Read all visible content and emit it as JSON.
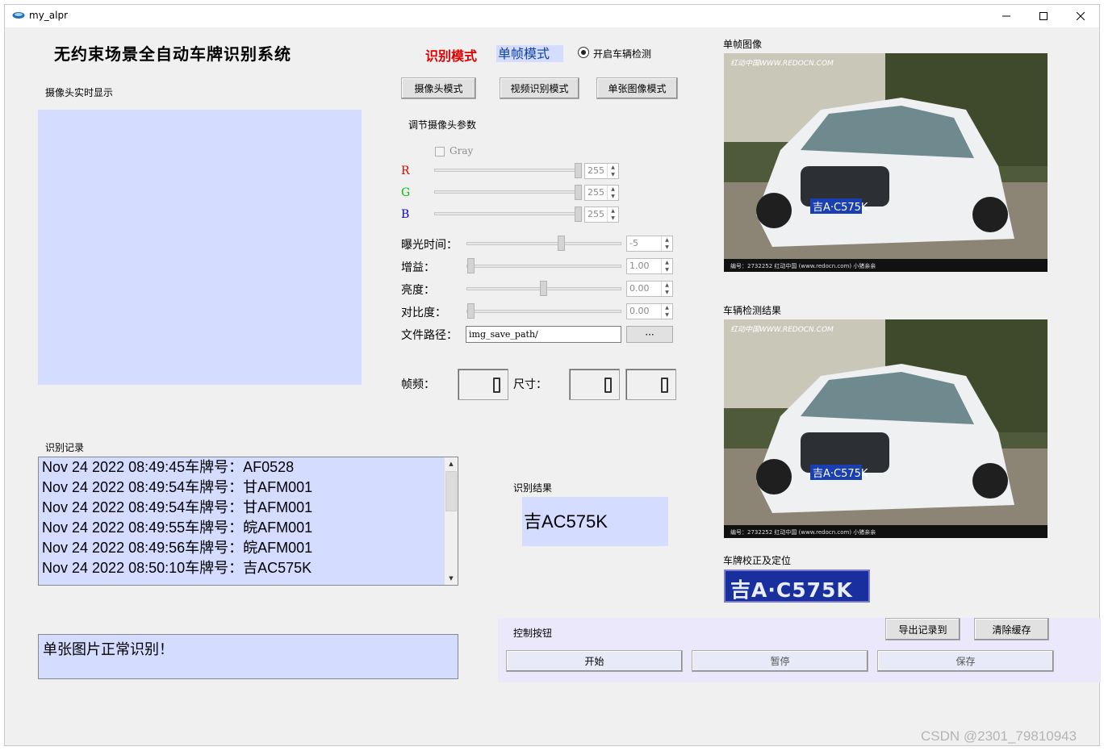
{
  "window": {
    "title": "my_alpr"
  },
  "header": {
    "system_title": "无约束场景全自动车牌识别系统",
    "mode_label": "识别模式",
    "mode_value": "单帧模式",
    "vehicle_detect_label": "开启车辆检测",
    "vehicle_detect_checked": true
  },
  "camera": {
    "label": "摄像头实时显示"
  },
  "mode_buttons": {
    "camera": "摄像头模式",
    "video": "视频识别模式",
    "single": "单张图像模式"
  },
  "params": {
    "title": "调节摄像头参数",
    "gray_label": "Gray",
    "r": {
      "label": "R",
      "value": "255",
      "color": "#e00000"
    },
    "g": {
      "label": "G",
      "value": "255",
      "color": "#00c000"
    },
    "b": {
      "label": "B",
      "value": "255",
      "color": "#0000e0"
    },
    "exposure": {
      "label": "曝光时间：",
      "value": "-5"
    },
    "gain": {
      "label": "增益：",
      "value": "1.00"
    },
    "brightness": {
      "label": "亮度：",
      "value": "0.00"
    },
    "contrast": {
      "label": "对比度：",
      "value": "0.00"
    },
    "filepath": {
      "label": "文件路径：",
      "value": "img_save_path/",
      "browse": "···"
    },
    "fps_label": "帧频：",
    "fps_value": "0",
    "size_label": "尺寸：",
    "size_w": "0",
    "size_h": "0"
  },
  "records": {
    "label": "识别记录",
    "items": [
      "Nov 24 2022 08:49:45车牌号：AF0528",
      "Nov 24 2022 08:49:54车牌号：甘AFM001",
      "Nov 24 2022 08:49:54车牌号：甘AFM001",
      "Nov 24 2022 08:49:55车牌号：皖AFM001",
      "Nov 24 2022 08:49:56车牌号：皖AFM001",
      "Nov 24 2022 08:50:10车牌号：吉AC575K"
    ]
  },
  "status_text": "单张图片正常识别！",
  "result": {
    "label": "识别结果",
    "value": "吉AC575K"
  },
  "images": {
    "frame_label": "单帧图像",
    "detect_label": "车辆检测结果",
    "plate_label": "车牌校正及定位",
    "watermark_top": "红动中国WWW.REDOCN.COM",
    "watermark_bottom": "编号：2732252   红动中国 (www.redocn.com)   小猪亲亲",
    "plate_text": "吉A·C575K"
  },
  "controls": {
    "label": "控制按钮",
    "export": "导出记录到",
    "clear": "清除缓存",
    "start": "开始",
    "pause": "暂停",
    "save": "保存"
  },
  "watermark": "CSDN @2301_79810943"
}
